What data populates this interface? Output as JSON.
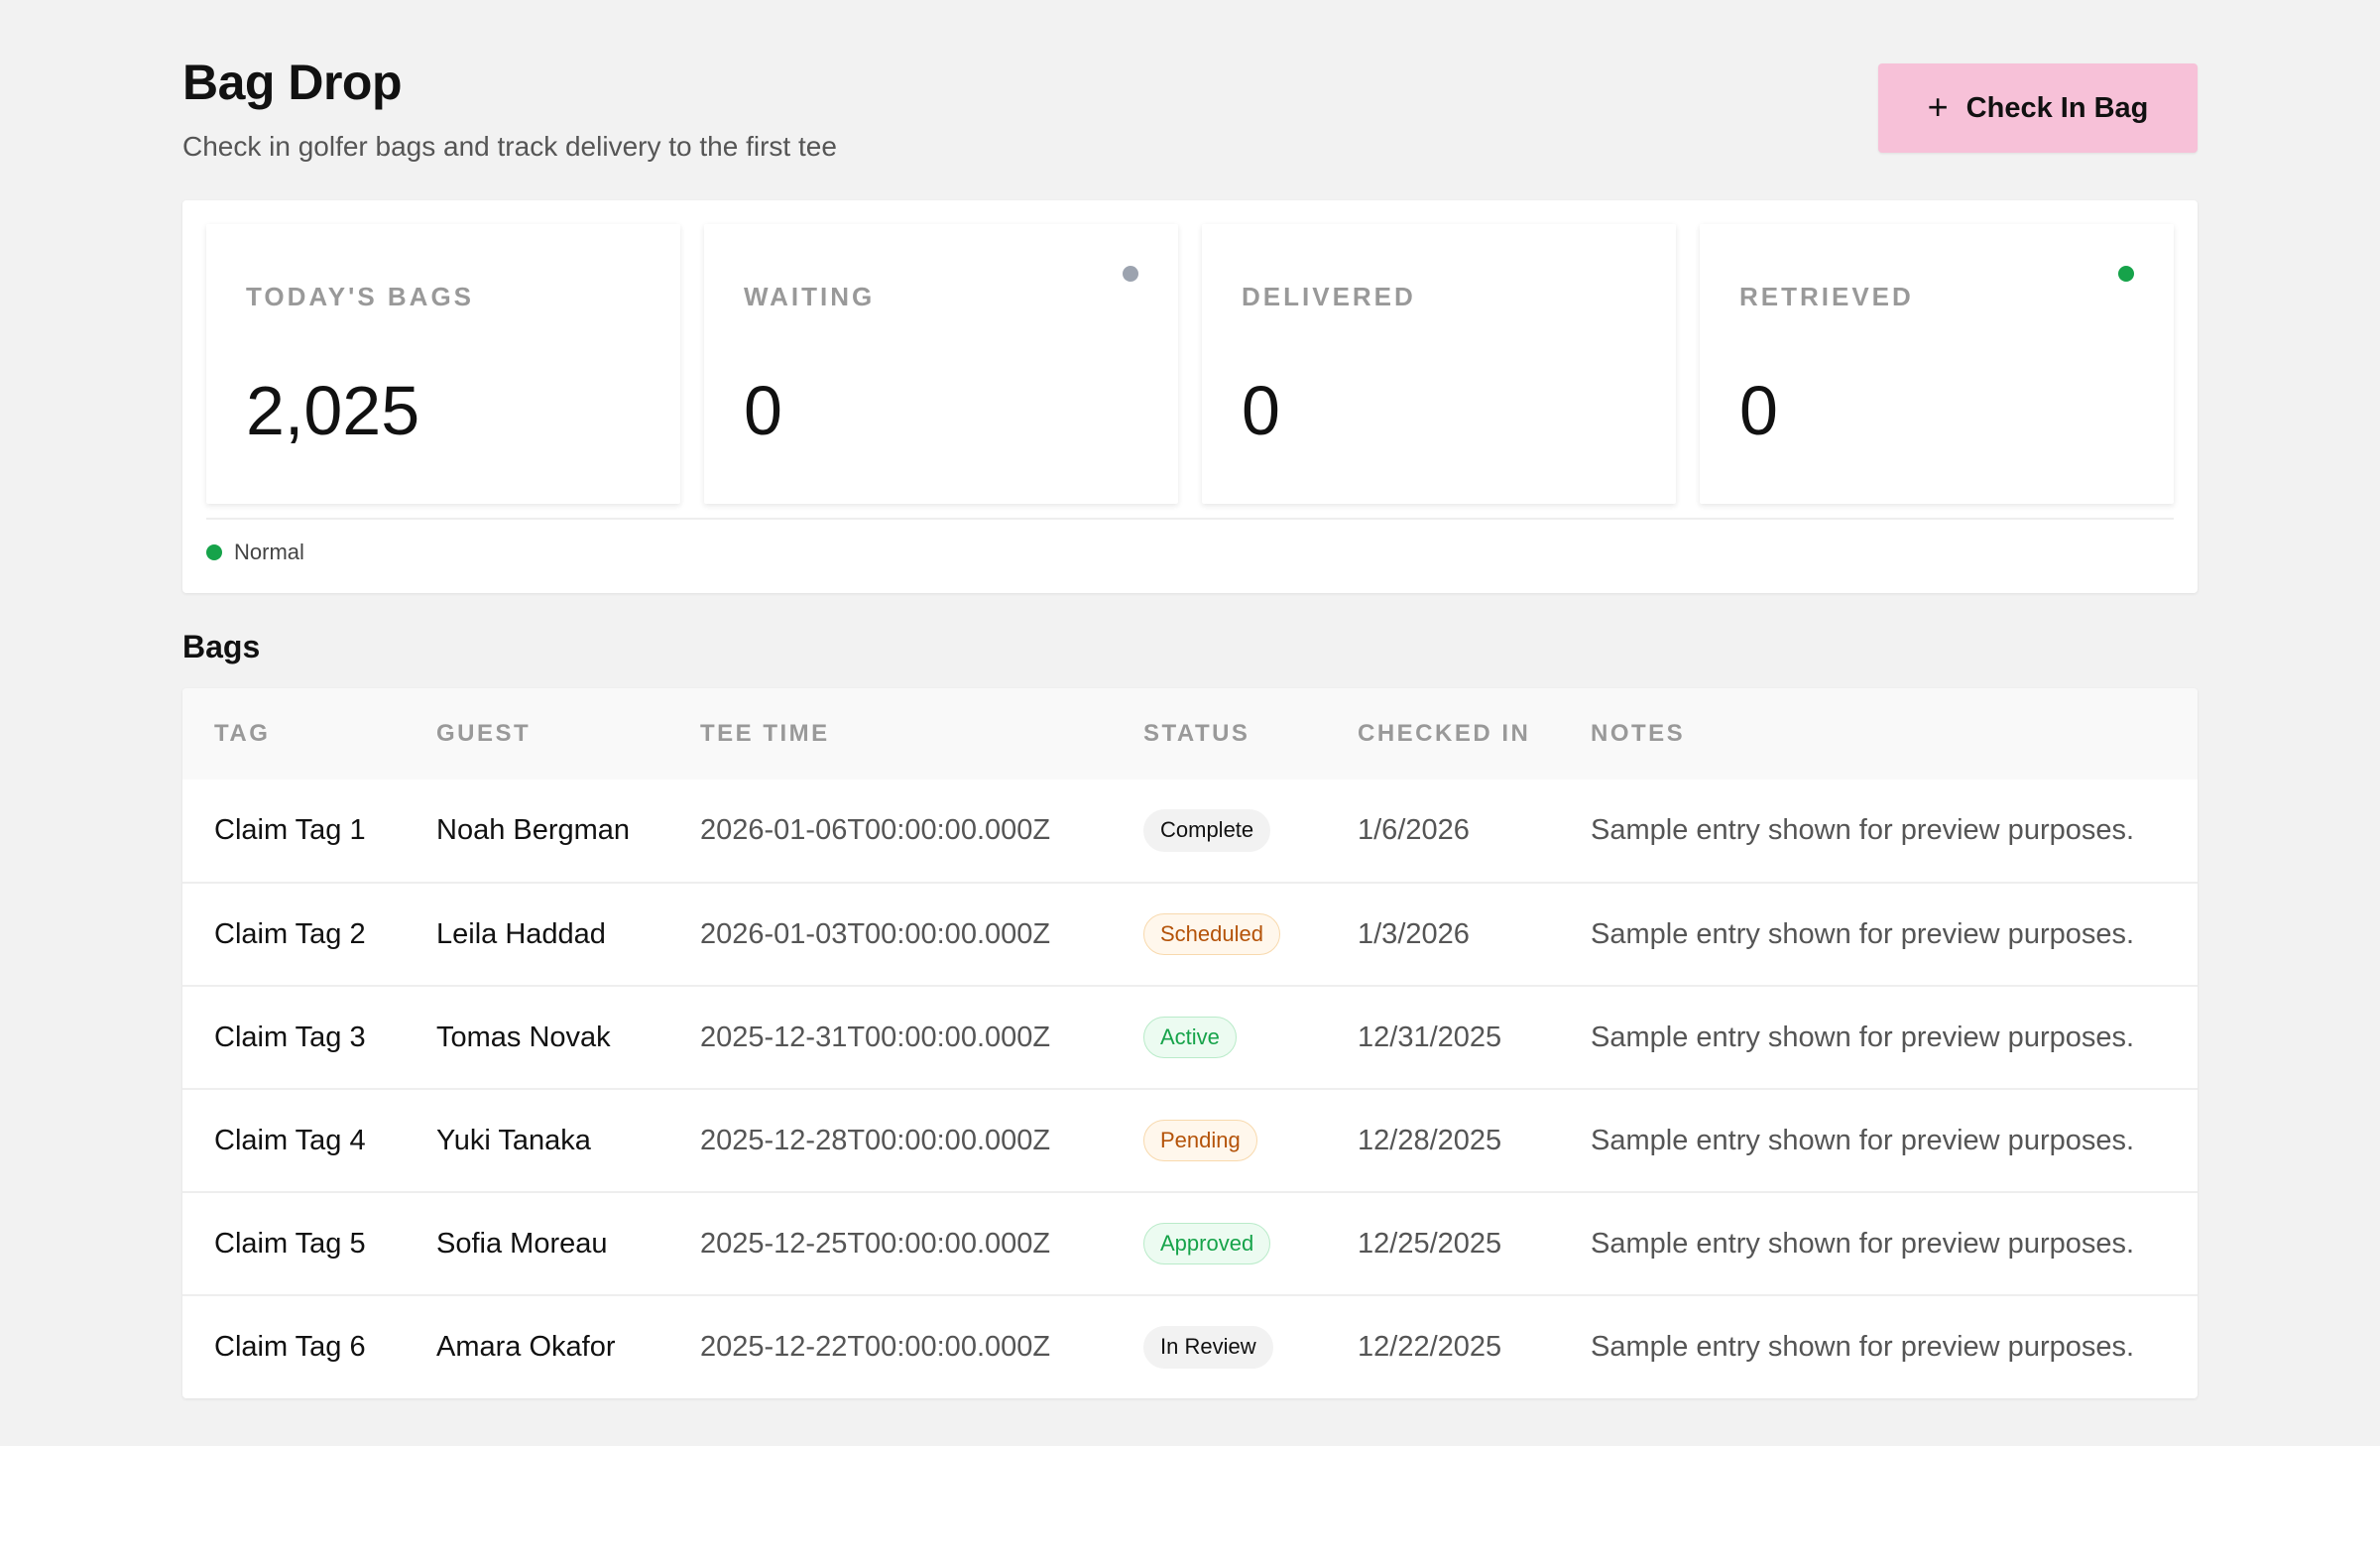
{
  "header": {
    "title": "Bag Drop",
    "subtitle": "Check in golfer bags and track delivery to the first tee",
    "checkin_label": "Check In Bag",
    "checkin_icon": "plus-icon"
  },
  "stats": [
    {
      "label": "TODAY'S BAGS",
      "value": "2,025",
      "dot": null
    },
    {
      "label": "WAITING",
      "value": "0",
      "dot": "#9ca3af"
    },
    {
      "label": "DELIVERED",
      "value": "0",
      "dot": null
    },
    {
      "label": "RETRIEVED",
      "value": "0",
      "dot": "#16a34a"
    }
  ],
  "legend": {
    "label": "Normal",
    "color": "#16a34a"
  },
  "bags": {
    "title": "Bags",
    "columns": [
      "TAG",
      "GUEST",
      "TEE TIME",
      "STATUS",
      "CHECKED IN",
      "NOTES"
    ],
    "rows": [
      {
        "tag": "Claim Tag 1",
        "guest": "Noah Bergman",
        "tee_time": "2026-01-06T00:00:00.000Z",
        "status": "Complete",
        "status_kind": "neutral",
        "checked_in": "1/6/2026",
        "notes": "Sample entry shown for preview purposes."
      },
      {
        "tag": "Claim Tag 2",
        "guest": "Leila Haddad",
        "tee_time": "2026-01-03T00:00:00.000Z",
        "status": "Scheduled",
        "status_kind": "warn",
        "checked_in": "1/3/2026",
        "notes": "Sample entry shown for preview purposes."
      },
      {
        "tag": "Claim Tag 3",
        "guest": "Tomas Novak",
        "tee_time": "2025-12-31T00:00:00.000Z",
        "status": "Active",
        "status_kind": "ok",
        "checked_in": "12/31/2025",
        "notes": "Sample entry shown for preview purposes."
      },
      {
        "tag": "Claim Tag 4",
        "guest": "Yuki Tanaka",
        "tee_time": "2025-12-28T00:00:00.000Z",
        "status": "Pending",
        "status_kind": "warn",
        "checked_in": "12/28/2025",
        "notes": "Sample entry shown for preview purposes."
      },
      {
        "tag": "Claim Tag 5",
        "guest": "Sofia Moreau",
        "tee_time": "2025-12-25T00:00:00.000Z",
        "status": "Approved",
        "status_kind": "ok",
        "checked_in": "12/25/2025",
        "notes": "Sample entry shown for preview purposes."
      },
      {
        "tag": "Claim Tag 6",
        "guest": "Amara Okafor",
        "tee_time": "2025-12-22T00:00:00.000Z",
        "status": "In Review",
        "status_kind": "neutral",
        "checked_in": "12/22/2025",
        "notes": "Sample entry shown for preview purposes."
      }
    ]
  },
  "colors": {
    "accent": "#f7c1d8",
    "page_bg": "#f2f2f2",
    "ok": "#16a34a",
    "warn": "#b45309",
    "muted_dot": "#9ca3af"
  }
}
